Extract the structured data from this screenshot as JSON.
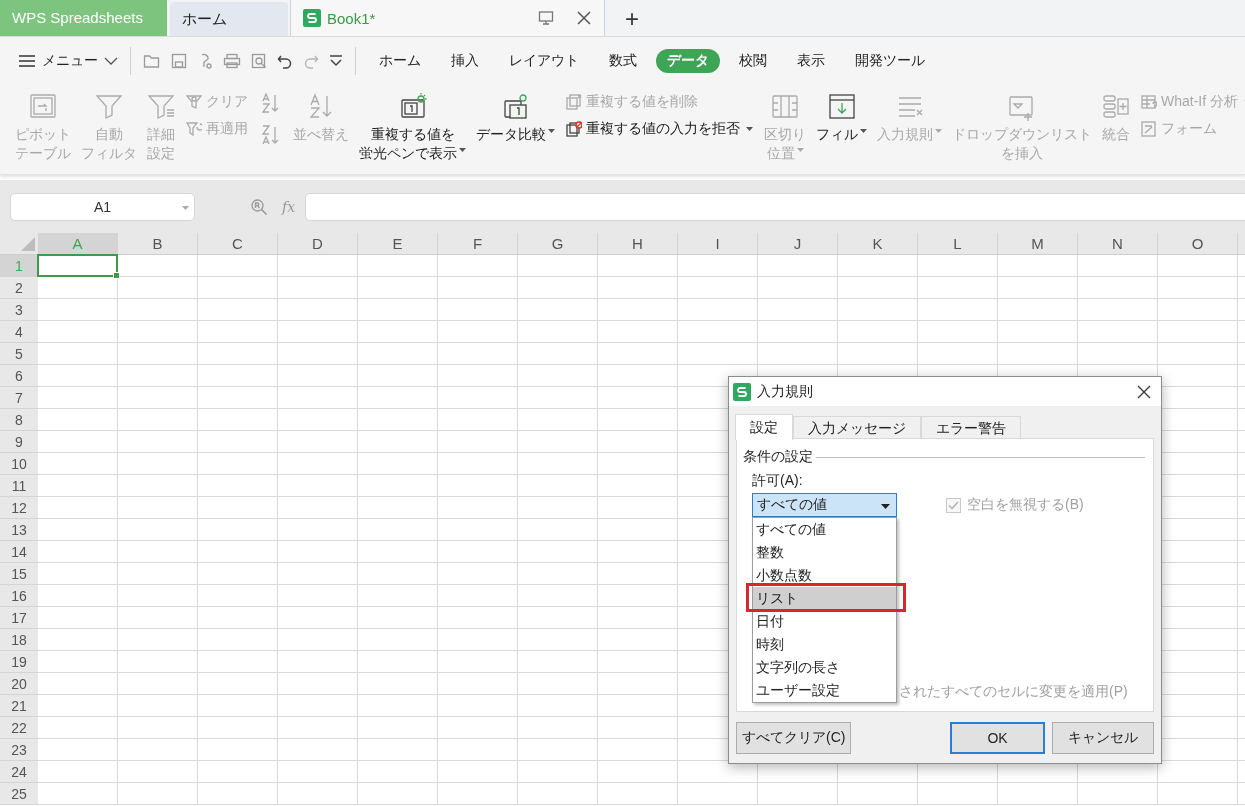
{
  "app_tabs": [
    {
      "label": "WPS Spreadsheets",
      "kind": "app",
      "selected": false
    },
    {
      "label": "ホーム",
      "kind": "home",
      "selected": false
    },
    {
      "label": "Book1*",
      "kind": "document",
      "selected": true
    }
  ],
  "new_tab_label": "+",
  "menu_button": {
    "label": "メニュー"
  },
  "ribbon_tabs": [
    {
      "label": "ホーム",
      "selected": false
    },
    {
      "label": "挿入",
      "selected": false
    },
    {
      "label": "レイアウト",
      "selected": false
    },
    {
      "label": "数式",
      "selected": false
    },
    {
      "label": "データ",
      "selected": true
    },
    {
      "label": "校閲",
      "selected": false
    },
    {
      "label": "表示",
      "selected": false
    },
    {
      "label": "開発ツール",
      "selected": false
    }
  ],
  "ribbon": [
    {
      "kind": "large",
      "lines": [
        "ピボット",
        "テーブル"
      ],
      "disabled": true,
      "menu": false
    },
    {
      "kind": "large",
      "lines": [
        "自動",
        "フィルタ"
      ],
      "disabled": true,
      "menu": false
    },
    {
      "kind": "large",
      "lines": [
        "詳細",
        "設定"
      ],
      "disabled": true,
      "menu": false
    },
    {
      "kind": "stack",
      "items": [
        {
          "label": "クリア",
          "disabled": true,
          "menu": false
        },
        {
          "label": "再適用",
          "disabled": true,
          "menu": false
        }
      ]
    },
    {
      "kind": "sort",
      "disabled": true
    },
    {
      "kind": "large",
      "lines": [
        "並べ替え"
      ],
      "disabled": true,
      "menu": false
    },
    {
      "kind": "large",
      "lines": [
        "重複する値を",
        "蛍光ペンで表示"
      ],
      "disabled": false,
      "menu": true
    },
    {
      "kind": "large",
      "lines": [
        "データ比較"
      ],
      "disabled": false,
      "menu": true
    },
    {
      "kind": "stack",
      "items": [
        {
          "label": "重複する値を削除",
          "disabled": true,
          "menu": false
        },
        {
          "label": "重複する値の入力を拒否",
          "disabled": false,
          "menu": true
        }
      ]
    },
    {
      "kind": "large",
      "lines": [
        "区切り",
        "位置"
      ],
      "disabled": true,
      "menu": true
    },
    {
      "kind": "large",
      "lines": [
        "フィル"
      ],
      "disabled": false,
      "menu": true
    },
    {
      "kind": "large",
      "lines": [
        "入力規則"
      ],
      "disabled": true,
      "menu": true
    },
    {
      "kind": "large",
      "lines": [
        "ドロップダウンリスト",
        "を挿入"
      ],
      "disabled": true,
      "menu": false
    },
    {
      "kind": "large",
      "lines": [
        "統合"
      ],
      "disabled": true,
      "menu": false
    },
    {
      "kind": "stack",
      "items": [
        {
          "label": "What-If 分析",
          "disabled": true,
          "menu": true
        },
        {
          "label": "フォーム",
          "disabled": true,
          "menu": false
        }
      ]
    }
  ],
  "formula_bar": {
    "name_box": "A1",
    "function_label": "fx"
  },
  "sheet": {
    "columns": [
      {
        "label": "A",
        "selected": true
      },
      {
        "label": "B",
        "selected": false
      },
      {
        "label": "C",
        "selected": false
      },
      {
        "label": "D",
        "selected": false
      },
      {
        "label": "E",
        "selected": false
      },
      {
        "label": "F",
        "selected": false
      },
      {
        "label": "G",
        "selected": false
      },
      {
        "label": "H",
        "selected": false
      },
      {
        "label": "I",
        "selected": false
      },
      {
        "label": "J",
        "selected": false
      },
      {
        "label": "K",
        "selected": false
      },
      {
        "label": "L",
        "selected": false
      },
      {
        "label": "M",
        "selected": false
      },
      {
        "label": "N",
        "selected": false
      },
      {
        "label": "O",
        "selected": false
      }
    ],
    "rows": [
      {
        "label": "1",
        "selected": true
      },
      {
        "label": "2",
        "selected": false
      },
      {
        "label": "3",
        "selected": false
      },
      {
        "label": "4",
        "selected": false
      },
      {
        "label": "5",
        "selected": false
      },
      {
        "label": "6",
        "selected": false
      },
      {
        "label": "7",
        "selected": false
      },
      {
        "label": "8",
        "selected": false
      },
      {
        "label": "9",
        "selected": false
      },
      {
        "label": "10",
        "selected": false
      },
      {
        "label": "11",
        "selected": false
      },
      {
        "label": "12",
        "selected": false
      },
      {
        "label": "13",
        "selected": false
      },
      {
        "label": "14",
        "selected": false
      },
      {
        "label": "15",
        "selected": false
      },
      {
        "label": "16",
        "selected": false
      },
      {
        "label": "17",
        "selected": false
      },
      {
        "label": "18",
        "selected": false
      },
      {
        "label": "19",
        "selected": false
      },
      {
        "label": "20",
        "selected": false
      },
      {
        "label": "21",
        "selected": false
      },
      {
        "label": "22",
        "selected": false
      },
      {
        "label": "23",
        "selected": false
      },
      {
        "label": "24",
        "selected": false
      },
      {
        "label": "25",
        "selected": false
      }
    ]
  },
  "dialog": {
    "title": "入力規則",
    "tabs": [
      {
        "label": "設定",
        "selected": true
      },
      {
        "label": "入力メッセージ",
        "selected": false
      },
      {
        "label": "エラー警告",
        "selected": false
      }
    ],
    "group_label": "条件の設定",
    "allow_label": "許可(A):",
    "allow_value": "すべての値",
    "ignore_blank": {
      "label": "空白を無視する(B)",
      "checked": true,
      "disabled": true
    },
    "apply_all_label": "されたすべてのセルに変更を適用(P)",
    "options": [
      {
        "label": "すべての値",
        "highlighted": false,
        "framed": false
      },
      {
        "label": "整数",
        "highlighted": false,
        "framed": false
      },
      {
        "label": "小数点数",
        "highlighted": false,
        "framed": false
      },
      {
        "label": "リスト",
        "highlighted": true,
        "framed": true
      },
      {
        "label": "日付",
        "highlighted": false,
        "framed": false
      },
      {
        "label": "時刻",
        "highlighted": false,
        "framed": false
      },
      {
        "label": "文字列の長さ",
        "highlighted": false,
        "framed": false
      },
      {
        "label": "ユーザー設定",
        "highlighted": false,
        "framed": false
      }
    ],
    "buttons": [
      {
        "label": "すべてクリア(C)",
        "default": false
      },
      {
        "label": "OK",
        "default": true
      },
      {
        "label": "キャンセル",
        "default": false
      }
    ]
  }
}
